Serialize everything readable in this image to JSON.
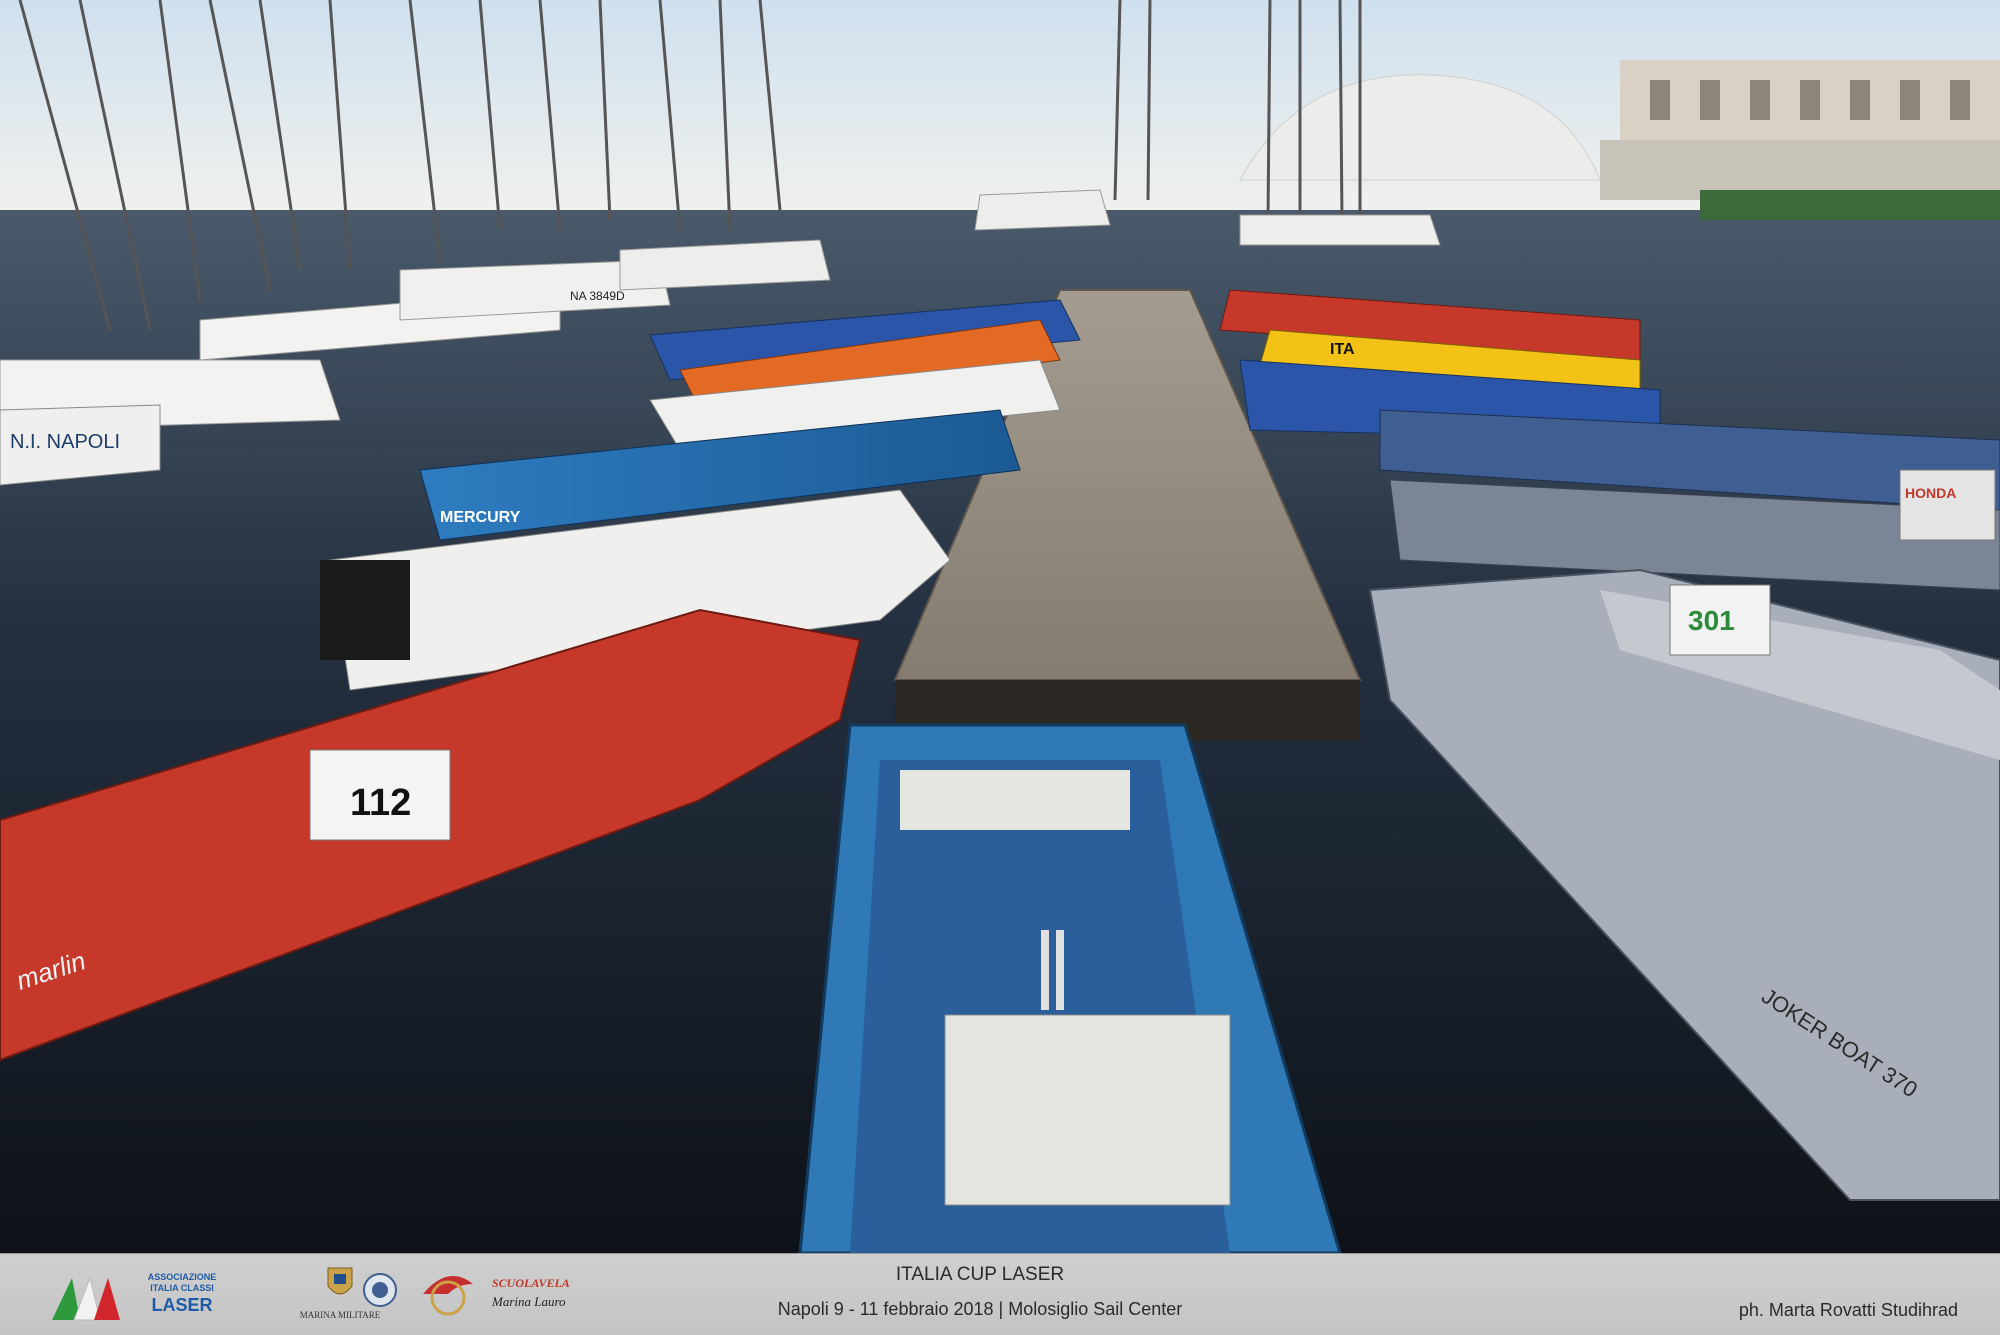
{
  "photo": {
    "description_icon": "marina-photo",
    "colors": {
      "water": "#1d2430",
      "sky": "#e9edf2",
      "dock": "#8f877c",
      "red_boat": "#c6382a",
      "blue_dinghy": "#2f79b6"
    },
    "boat_labels": {
      "boat_112": "112",
      "boat_301": "301",
      "mercury_brand": "MERCURY",
      "honda_brand": "HONDA",
      "joker_boat": "JOKER BOAT 370",
      "napoli_hull": "N.I. NAPOLI",
      "marlin_brand": "marlin",
      "na_reg": "NA 3849D",
      "ita_label": "ITA"
    }
  },
  "footer": {
    "laser_logo": {
      "line1": "ASSOCIAZIONE",
      "line2": "ITALIA CLASSI",
      "line3": "LASER",
      "icon": "laser-sail-flag-icon"
    },
    "sponsors": {
      "marina": "MARINA MILITARE",
      "scuola": "SCUOLAVELA",
      "scuola_sub": "Marina Lauro"
    },
    "event_title": "ITALIA CUP LASER",
    "event_subtitle": "Napoli 9 - 11 febbraio 2018 | Molosiglio Sail Center",
    "credit": "ph. Marta Rovatti Studihrad"
  }
}
